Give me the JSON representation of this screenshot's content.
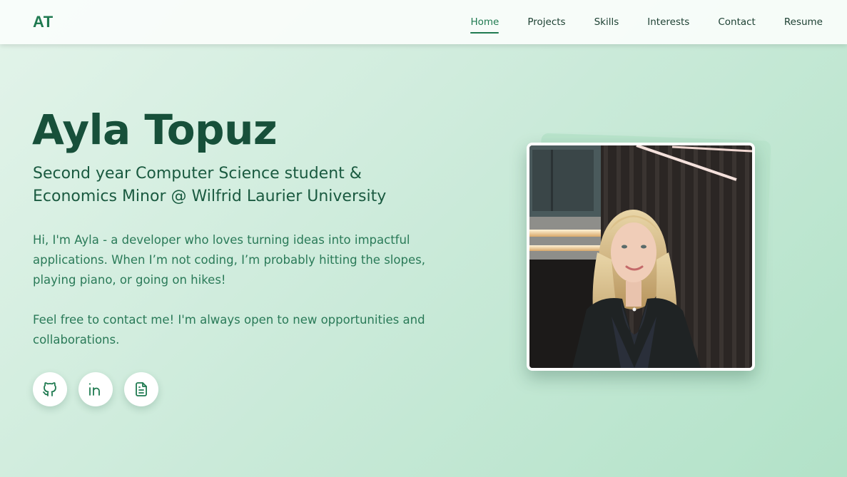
{
  "nav": {
    "logo": "AT",
    "links": [
      {
        "label": "Home",
        "active": true
      },
      {
        "label": "Projects"
      },
      {
        "label": "Skills"
      },
      {
        "label": "Interests"
      },
      {
        "label": "Contact"
      },
      {
        "label": "Resume"
      }
    ]
  },
  "hero": {
    "name": "Ayla Topuz",
    "subtitle": "Second year Computer Science student & Economics Minor @ Wilfrid Laurier University",
    "intro": "Hi, I'm Ayla - a developer who loves turning ideas into impactful applications. When I’m not coding, I’m probably hitting the slopes, playing piano, or going on hikes!",
    "contact_text": "Feel free to contact me! I'm always open to new opportunities and collaborations."
  },
  "socials": [
    {
      "icon": "github-icon"
    },
    {
      "icon": "linkedin-icon"
    },
    {
      "icon": "document-icon"
    }
  ],
  "colors": {
    "accent": "#1f7a50",
    "heading": "#17503a",
    "background_start": "#e3f4ea",
    "background_end": "#b2e2c8"
  }
}
